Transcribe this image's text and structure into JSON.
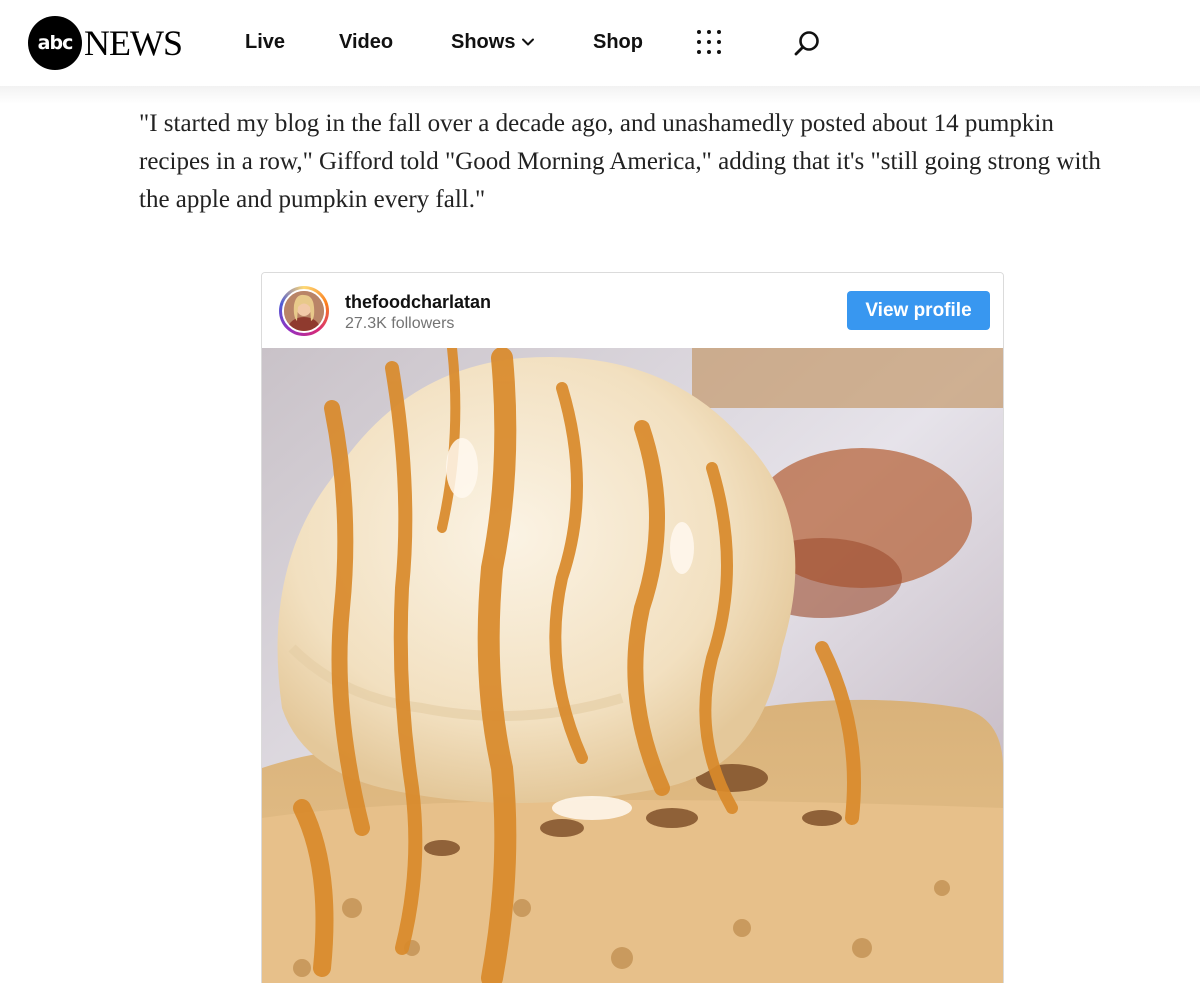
{
  "header": {
    "logo_abc": "abc",
    "logo_news": "NEWS",
    "nav": {
      "live": "Live",
      "video": "Video",
      "shows": "Shows",
      "shop": "Shop"
    },
    "icons": {
      "menu": "grid-dots-icon",
      "search": "search-icon",
      "shows_dropdown": "chevron-down-icon"
    }
  },
  "article": {
    "paragraph": "\"I started my blog in the fall over a decade ago, and unashamedly posted about 14 pumpkin recipes in a row,\" Gifford told \"Good Morning America,\" adding that it's \"still going strong with the apple and pumpkin every fall.\""
  },
  "embed": {
    "username": "thefoodcharlatan",
    "followers": "27.3K followers",
    "view_profile_label": "View profile",
    "accent_color": "#3897f0"
  }
}
